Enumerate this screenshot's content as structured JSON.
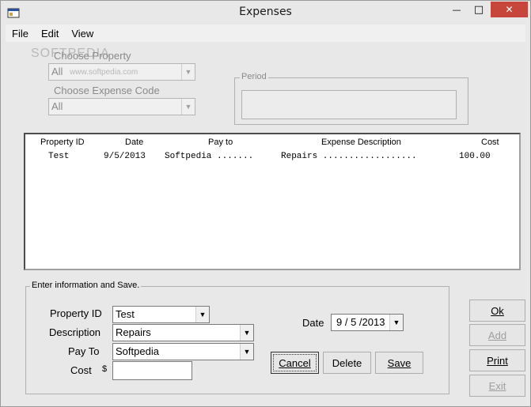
{
  "window": {
    "title": "Expenses",
    "minimize_glyph": "—",
    "maximize_glyph": "□",
    "close_glyph": "✕"
  },
  "menu": [
    "File",
    "Edit",
    "View"
  ],
  "filters": {
    "property_label": "Choose Property",
    "property_value": "All",
    "expense_code_label": "Choose Expense Code",
    "expense_code_value": "All",
    "period_label": "Period",
    "watermark_text": "SOFTPEDIA",
    "watermark_url": "www.softpedia.com"
  },
  "list": {
    "headers": [
      "Property ID",
      "Date",
      "Pay to",
      "Expense  Description",
      "Cost"
    ],
    "rows": [
      [
        "Test",
        "9/5/2013",
        "Softpedia  .......",
        "Repairs  ..................",
        "100.00"
      ]
    ]
  },
  "form": {
    "group_label": "Enter information and Save.",
    "property_id_label": "Property ID",
    "property_id_value": "Test",
    "description_label": "Description",
    "description_value": "Repairs",
    "pay_to_label": "Pay To",
    "pay_to_value": "Softpedia",
    "cost_label": "Cost",
    "currency_symbol": "$",
    "cost_value": "",
    "date_label": "Date",
    "date_value": "9 / 5 /2013",
    "cancel_label": "Cancel",
    "delete_label": "Delete",
    "save_label": "Save"
  },
  "side_buttons": {
    "ok": "Ok",
    "add": "Add",
    "print": "Print",
    "exit": "Exit"
  }
}
